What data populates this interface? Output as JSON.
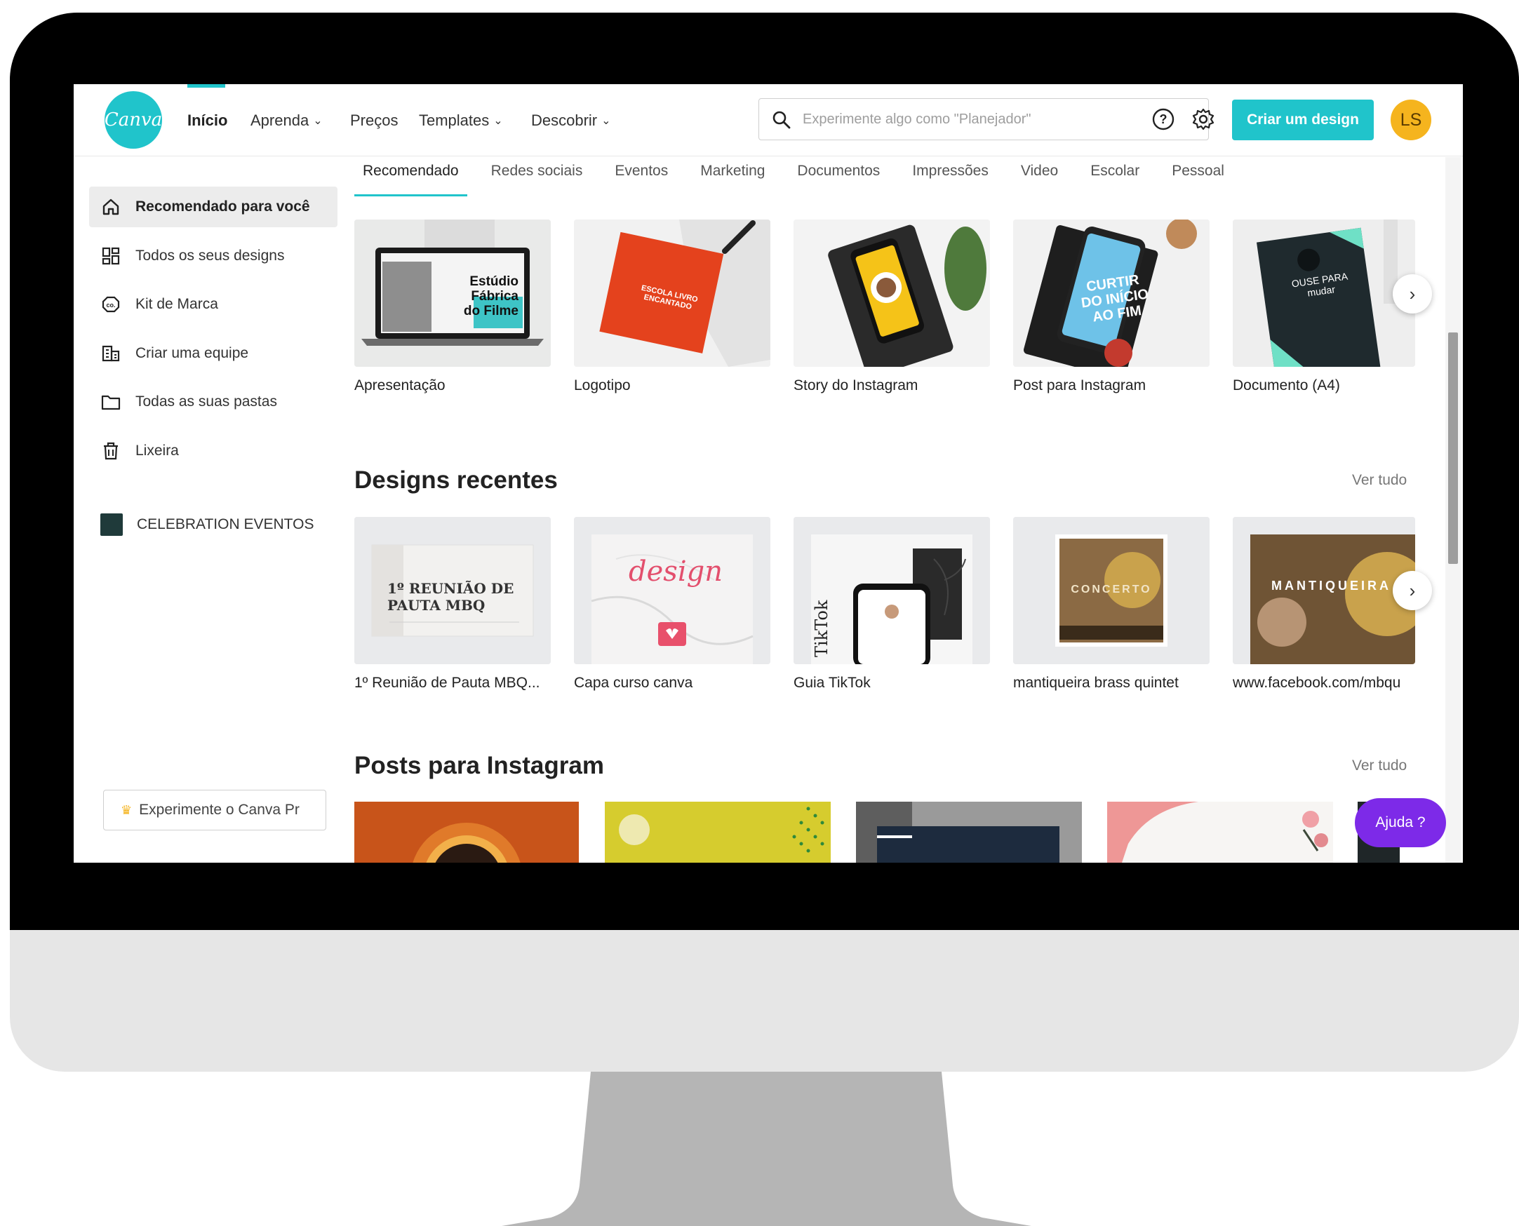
{
  "header": {
    "logo_text": "Canva",
    "nav": [
      {
        "label": "Início",
        "dropdown": false,
        "active": true
      },
      {
        "label": "Aprenda",
        "dropdown": true
      },
      {
        "label": "Preços",
        "dropdown": false
      },
      {
        "label": "Templates",
        "dropdown": true
      },
      {
        "label": "Descobrir",
        "dropdown": true
      }
    ],
    "search_placeholder": "Experimente algo como \"Planejador\"",
    "create_button": "Criar um design",
    "avatar_initials": "LS",
    "accent_color": "#20c4cb"
  },
  "sidebar": {
    "items": [
      {
        "label": "Recomendado para você",
        "icon": "home-icon",
        "active": true
      },
      {
        "label": "Todos os seus designs",
        "icon": "grid-icon"
      },
      {
        "label": "Kit de Marca",
        "icon": "brand-kit-icon"
      },
      {
        "label": "Criar uma equipe",
        "icon": "building-icon"
      },
      {
        "label": "Todas as suas pastas",
        "icon": "folder-icon"
      },
      {
        "label": "Lixeira",
        "icon": "trash-icon"
      }
    ],
    "team": "CELEBRATION EVENTOS",
    "try_pro": "Experimente o Canva Pr"
  },
  "tabs": [
    "Recomendado",
    "Redes sociais",
    "Eventos",
    "Marketing",
    "Documentos",
    "Impressões",
    "Video",
    "Escolar",
    "Pessoal"
  ],
  "recommended": [
    {
      "label": "Apresentação",
      "thumb_text": "Estúdio Fábrica do Filme"
    },
    {
      "label": "Logotipo",
      "thumb_text": "ESCOLA LIVRO ENCANTADO"
    },
    {
      "label": "Story do Instagram",
      "thumb_text": ""
    },
    {
      "label": "Post para Instagram",
      "thumb_text": "CURTIR DO INÍCIO AO FIM"
    },
    {
      "label": "Documento (A4)",
      "thumb_text": "OUSE PARA mudar"
    }
  ],
  "recent": {
    "title": "Designs recentes",
    "see_all": "Ver tudo",
    "items": [
      {
        "label": "1º Reunião de Pauta MBQ...",
        "thumb_text": "1º REUNIÃO DE PAUTA MBQ"
      },
      {
        "label": "Capa curso canva",
        "thumb_text": "design"
      },
      {
        "label": "Guia TikTok",
        "thumb_text": "TikTok"
      },
      {
        "label": "mantiqueira brass quintet",
        "thumb_text": "CONCERTO"
      },
      {
        "label": "www.facebook.com/mbqu",
        "thumb_text": "MANTIQUEIRA"
      }
    ]
  },
  "instagram": {
    "title": "Posts para Instagram",
    "see_all": "Ver tudo"
  },
  "help_button": "Ajuda  ?"
}
